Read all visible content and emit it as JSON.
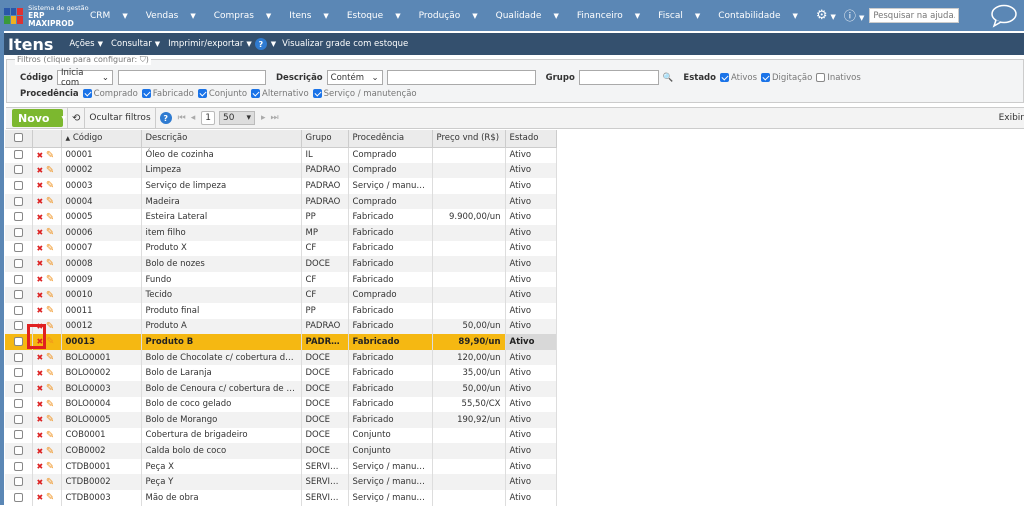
{
  "app": {
    "logo_line1": "Sistema de gestão",
    "logo_line2": "ERP MAXIPROD",
    "logo_colors": [
      "#2a57a8",
      "#2a57a8",
      "#d33",
      "#3a9a3a",
      "#f0b020",
      "#d33"
    ]
  },
  "nav": {
    "items": [
      "CRM",
      "Vendas",
      "Compras",
      "Itens",
      "Estoque",
      "Produção",
      "Qualidade",
      "Financeiro",
      "Fiscal",
      "Contabilidade"
    ],
    "help_placeholder": "Pesquisar na ajuda..."
  },
  "page": {
    "title": "Itens",
    "menu": [
      "Ações",
      "Consultar",
      "Imprimir/exportar"
    ],
    "help_glyph": "?",
    "grade": "Visualizar grade com estoque"
  },
  "filters": {
    "legend": "Filtros (clique para configurar:",
    "legend_end": ")",
    "codigo_label": "Código",
    "codigo_op": "Inicia com",
    "descricao_label": "Descrição",
    "descricao_op": "Contém",
    "grupo_label": "Grupo",
    "estado_label": "Estado",
    "estado": [
      {
        "label": "Ativos",
        "checked": true
      },
      {
        "label": "Digitação",
        "checked": true
      },
      {
        "label": "Inativos",
        "checked": false
      }
    ],
    "procedencia_label": "Procedência",
    "procedencia": [
      {
        "label": "Comprado",
        "checked": true
      },
      {
        "label": "Fabricado",
        "checked": true
      },
      {
        "label": "Conjunto",
        "checked": true
      },
      {
        "label": "Alternativo",
        "checked": true
      },
      {
        "label": "Serviço / manutenção",
        "checked": true
      }
    ]
  },
  "toolbar": {
    "novo": "Novo",
    "ocultar": "Ocultar filtros",
    "page": "1",
    "page_size": "50",
    "exibir": "Exibir"
  },
  "table": {
    "headers": [
      "Código",
      "Descrição",
      "Grupo",
      "Procedência",
      "Preço vnd (R$)",
      "Estado"
    ],
    "rows": [
      [
        "00001",
        "Óleo de cozinha",
        "IL",
        "Comprado",
        "",
        "Ativo"
      ],
      [
        "00002",
        "Limpeza",
        "PADRAO",
        "Comprado",
        "",
        "Ativo"
      ],
      [
        "00003",
        "Serviço de limpeza",
        "PADRAO",
        "Serviço / manute...",
        "",
        "Ativo"
      ],
      [
        "00004",
        "Madeira",
        "PADRAO",
        "Comprado",
        "",
        "Ativo"
      ],
      [
        "00005",
        "Esteira Lateral",
        "PP",
        "Fabricado",
        "9.900,00/un",
        "Ativo"
      ],
      [
        "00006",
        "item filho",
        "MP",
        "Fabricado",
        "",
        "Ativo"
      ],
      [
        "00007",
        "Produto X",
        "CF",
        "Fabricado",
        "",
        "Ativo"
      ],
      [
        "00008",
        "Bolo de nozes",
        "DOCE",
        "Fabricado",
        "",
        "Ativo"
      ],
      [
        "00009",
        "Fundo",
        "CF",
        "Fabricado",
        "",
        "Ativo"
      ],
      [
        "00010",
        "Tecido",
        "CF",
        "Comprado",
        "",
        "Ativo"
      ],
      [
        "00011",
        "Produto final",
        "PP",
        "Fabricado",
        "",
        "Ativo"
      ],
      [
        "00012",
        "Produto A",
        "PADRAO",
        "Fabricado",
        "50,00/un",
        "Ativo"
      ],
      [
        "00013",
        "Produto B",
        "PADRAO",
        "Fabricado",
        "89,90/un",
        "Ativo"
      ],
      [
        "BOLO0001",
        "Bolo de Chocolate c/ cobertura de br...",
        "DOCE",
        "Fabricado",
        "120,00/un",
        "Ativo"
      ],
      [
        "BOLO0002",
        "Bolo de Laranja",
        "DOCE",
        "Fabricado",
        "35,00/un",
        "Ativo"
      ],
      [
        "BOLO0003",
        "Bolo de Cenoura c/ cobertura de cho...",
        "DOCE",
        "Fabricado",
        "50,00/un",
        "Ativo"
      ],
      [
        "BOLO0004",
        "Bolo de coco gelado",
        "DOCE",
        "Fabricado",
        "55,50/CX",
        "Ativo"
      ],
      [
        "BOLO0005",
        "Bolo de Morango",
        "DOCE",
        "Fabricado",
        "190,92/un",
        "Ativo"
      ],
      [
        "COB0001",
        "Cobertura de brigadeiro",
        "DOCE",
        "Conjunto",
        "",
        "Ativo"
      ],
      [
        "COB0002",
        "Calda bolo de coco",
        "DOCE",
        "Conjunto",
        "",
        "Ativo"
      ],
      [
        "CTDB0001",
        "Peça X",
        "SERVIC...",
        "Serviço / manute...",
        "",
        "Ativo"
      ],
      [
        "CTDB0002",
        "Peça Y",
        "SERVIC...",
        "Serviço / manute...",
        "",
        "Ativo"
      ],
      [
        "CTDB0003",
        "Mão de obra",
        "SERVIC...",
        "Serviço / manute...",
        "",
        "Ativo"
      ]
    ],
    "selected_code": "00013"
  },
  "colors": {
    "nav": "#5b87b5",
    "titlebar": "#34506e",
    "selected": "#f5b812",
    "novo": "#7cb82f",
    "highlight": "#e02020"
  }
}
